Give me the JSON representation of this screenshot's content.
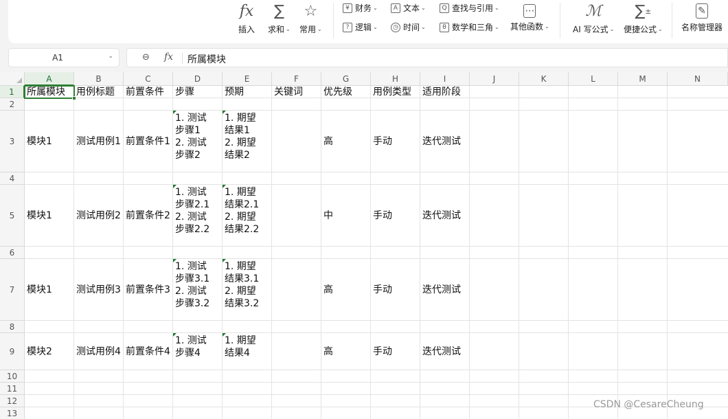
{
  "ribbon": {
    "insert_fn": "插入",
    "sum": "求和",
    "common": "常用",
    "finance": "财务",
    "text": "文本",
    "lookup": "查找与引用",
    "logic": "逻辑",
    "time": "时间",
    "math": "数学和三角",
    "other": "其他函数",
    "ai_formula": "AI 写公式",
    "quick_formula": "便捷公式",
    "name_manager": "名称管理器"
  },
  "formula_bar": {
    "cell_ref": "A1",
    "content": "所属模块"
  },
  "columns": [
    "A",
    "B",
    "C",
    "D",
    "E",
    "F",
    "G",
    "H",
    "I",
    "J",
    "K",
    "L",
    "M",
    "N"
  ],
  "rows": [
    "1",
    "2",
    "3",
    "4",
    "5",
    "6",
    "7",
    "8",
    "9",
    "10",
    "11",
    "12",
    "13"
  ],
  "sheet": {
    "r1": {
      "a": "所属模块",
      "b": "用例标题",
      "c": "前置条件",
      "d": "步骤",
      "e": "预期",
      "f": "关键词",
      "g": "优先级",
      "h": "用例类型",
      "i": "适用阶段"
    },
    "r3": {
      "a": "模块1",
      "b": "测试用例1",
      "c": "前置条件1",
      "d": "1. 测试\n步骤1\n2. 测试\n步骤2",
      "e": "1. 期望\n结果1\n2. 期望\n结果2",
      "g": "高",
      "h": "手动",
      "i": "迭代测试"
    },
    "r5": {
      "a": "模块1",
      "b": "测试用例2",
      "c": "前置条件2",
      "d": "1. 测试\n步骤2.1\n2. 测试\n步骤2.2",
      "e": "1. 期望\n结果2.1\n2. 期望\n结果2.2",
      "g": "中",
      "h": "手动",
      "i": "迭代测试"
    },
    "r7": {
      "a": "模块1",
      "b": "测试用例3",
      "c": "前置条件3",
      "d": "1. 测试\n步骤3.1\n2. 测试\n步骤3.2",
      "e": "1. 期望\n结果3.1\n2. 期望\n结果3.2",
      "g": "高",
      "h": "手动",
      "i": "迭代测试"
    },
    "r9": {
      "a": "模块2",
      "b": "测试用例4",
      "c": "前置条件4",
      "d": "1. 测试\n步骤4",
      "e": "1. 期望\n结果4",
      "g": "高",
      "h": "手动",
      "i": "迭代测试"
    }
  },
  "watermark": "CSDN @CesareCheung",
  "colors": {
    "accent": "#2e7d32"
  }
}
